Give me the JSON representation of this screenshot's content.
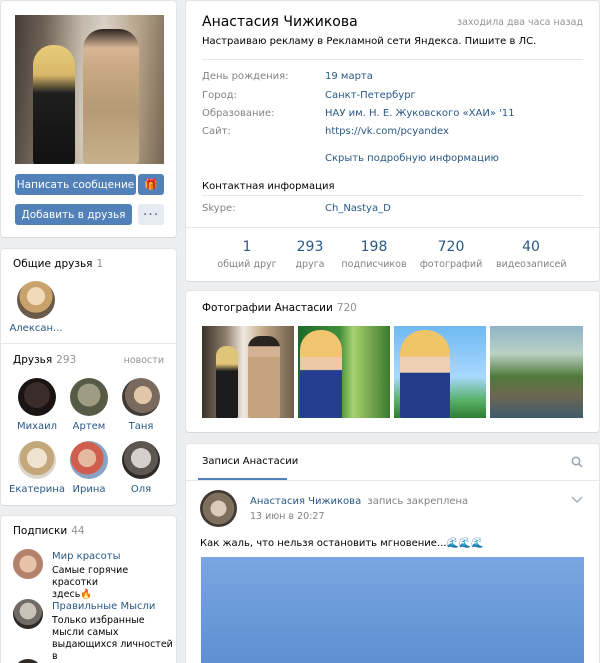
{
  "profile": {
    "name": "Анастасия Чижикова",
    "last_seen": "заходила два часа назад",
    "status": "Настраиваю рекламу в Рекламной сети Яндекса. Пишите в ЛС.",
    "info": [
      {
        "label": "День рождения:",
        "value": "19 марта"
      },
      {
        "label": "Город:",
        "value": "Санкт-Петербург"
      },
      {
        "label": "Образование:",
        "value": "НАУ им. Н. Е. Жуковского «ХАИ» '11"
      },
      {
        "label": "Сайт:",
        "value": "https://vk.com/pcyandex"
      }
    ],
    "hide_info": "Скрыть подробную информацию",
    "contact_title": "Контактная информация",
    "skype_label": "Skype:",
    "skype_value": "Ch_Nastya_D"
  },
  "counters": [
    {
      "num": "1",
      "label": "общий друг"
    },
    {
      "num": "293",
      "label": "друга"
    },
    {
      "num": "198",
      "label": "подписчиков"
    },
    {
      "num": "720",
      "label": "фотографий"
    },
    {
      "num": "40",
      "label": "видеозаписей"
    }
  ],
  "actions": {
    "send_message": "Написать сообщение",
    "add_friend": "Добавить в друзья",
    "gift_icon": "gift-icon",
    "more_icon": "more-icon"
  },
  "common_friends": {
    "title": "Общие друзья",
    "count": "1",
    "items": [
      {
        "name": "Алексан..."
      }
    ]
  },
  "friends": {
    "title": "Друзья",
    "count": "293",
    "news_link": "новости",
    "items": [
      {
        "name": "Михаил"
      },
      {
        "name": "Артем"
      },
      {
        "name": "Таня"
      },
      {
        "name": "Екатерина"
      },
      {
        "name": "Ирина"
      },
      {
        "name": "Оля"
      }
    ]
  },
  "subscriptions": {
    "title": "Подписки",
    "count": "44",
    "items": [
      {
        "title": "Мир красоты",
        "desc_line1": "Самые горячие красотки",
        "desc_line2": "здесь🔥"
      },
      {
        "title": "Правильные Мысли",
        "desc_line1": "Только избранные",
        "desc_line2": "мысли самых",
        "desc_line3": "выдающихся личностей в"
      }
    ]
  },
  "photos": {
    "title": "Фотографии Анастасии",
    "count": "720"
  },
  "wall": {
    "tab": "Записи Анастасии",
    "post_author": "Анастасия Чижикова",
    "post_pinned": "запись закреплена",
    "post_date": "13 июн в 20:27",
    "post_text": "Как жаль, что нельзя остановить мгновение...🌊🌊🌊",
    "search_icon": "search-icon",
    "chevron_icon": "chevron-down-icon"
  }
}
